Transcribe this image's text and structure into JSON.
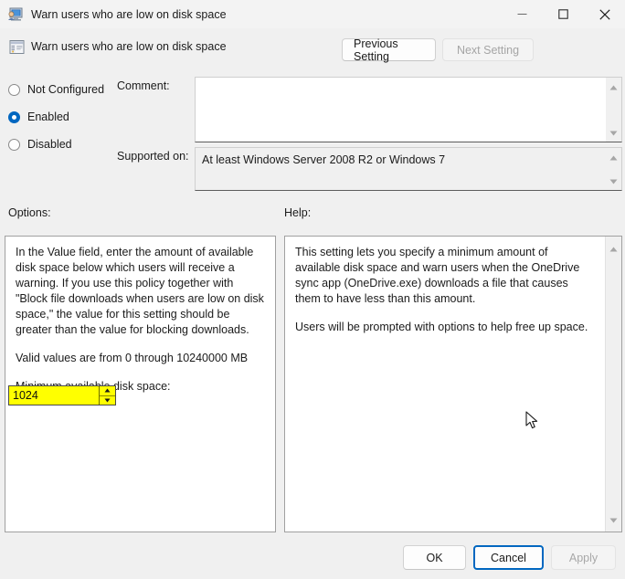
{
  "window": {
    "title": "Warn users who are low on disk space",
    "icon": "policy-window-icon",
    "minimize_label": "Minimize",
    "maximize_label": "Maximize",
    "close_label": "Close"
  },
  "header": {
    "setting_name": "Warn users who are low on disk space",
    "setting_icon": "policy-setting-icon",
    "previous_setting": "Previous Setting",
    "next_setting": "Next Setting"
  },
  "state": {
    "options": [
      {
        "label": "Not Configured",
        "selected": false
      },
      {
        "label": "Enabled",
        "selected": true
      },
      {
        "label": "Disabled",
        "selected": false
      }
    ]
  },
  "comment": {
    "label": "Comment:",
    "value": ""
  },
  "supported": {
    "label": "Supported on:",
    "value": "At least Windows Server 2008 R2 or Windows 7"
  },
  "options_panel": {
    "label": "Options:",
    "paragraphs": [
      "In the Value field, enter the amount of available disk space below which users will receive a warning. If you use this policy together with \"Block file downloads when users are low on disk space,\" the value for this setting should be greater than the value for blocking downloads.",
      "Valid values are from 0 through 10240000 MB",
      "Minimum available disk space:"
    ],
    "spinner": {
      "label": "Minimum available disk space:",
      "value": "1024",
      "highlight_color": "#ffff00",
      "increment_icon": "spin-up-icon",
      "decrement_icon": "spin-down-icon"
    }
  },
  "help_panel": {
    "label": "Help:",
    "paragraphs": [
      "This setting lets you specify a minimum amount of available disk space and warn users when the OneDrive sync app (OneDrive.exe) downloads a file that causes them to have less than this amount.",
      "Users will be prompted with options to help free up space."
    ]
  },
  "footer": {
    "ok": "OK",
    "cancel": "Cancel",
    "apply": "Apply"
  },
  "colors": {
    "accent": "#0067c0",
    "dialog_background": "#f0f0f0",
    "titlebar_background": "#f3f3f3",
    "highlight": "#ffff00"
  }
}
